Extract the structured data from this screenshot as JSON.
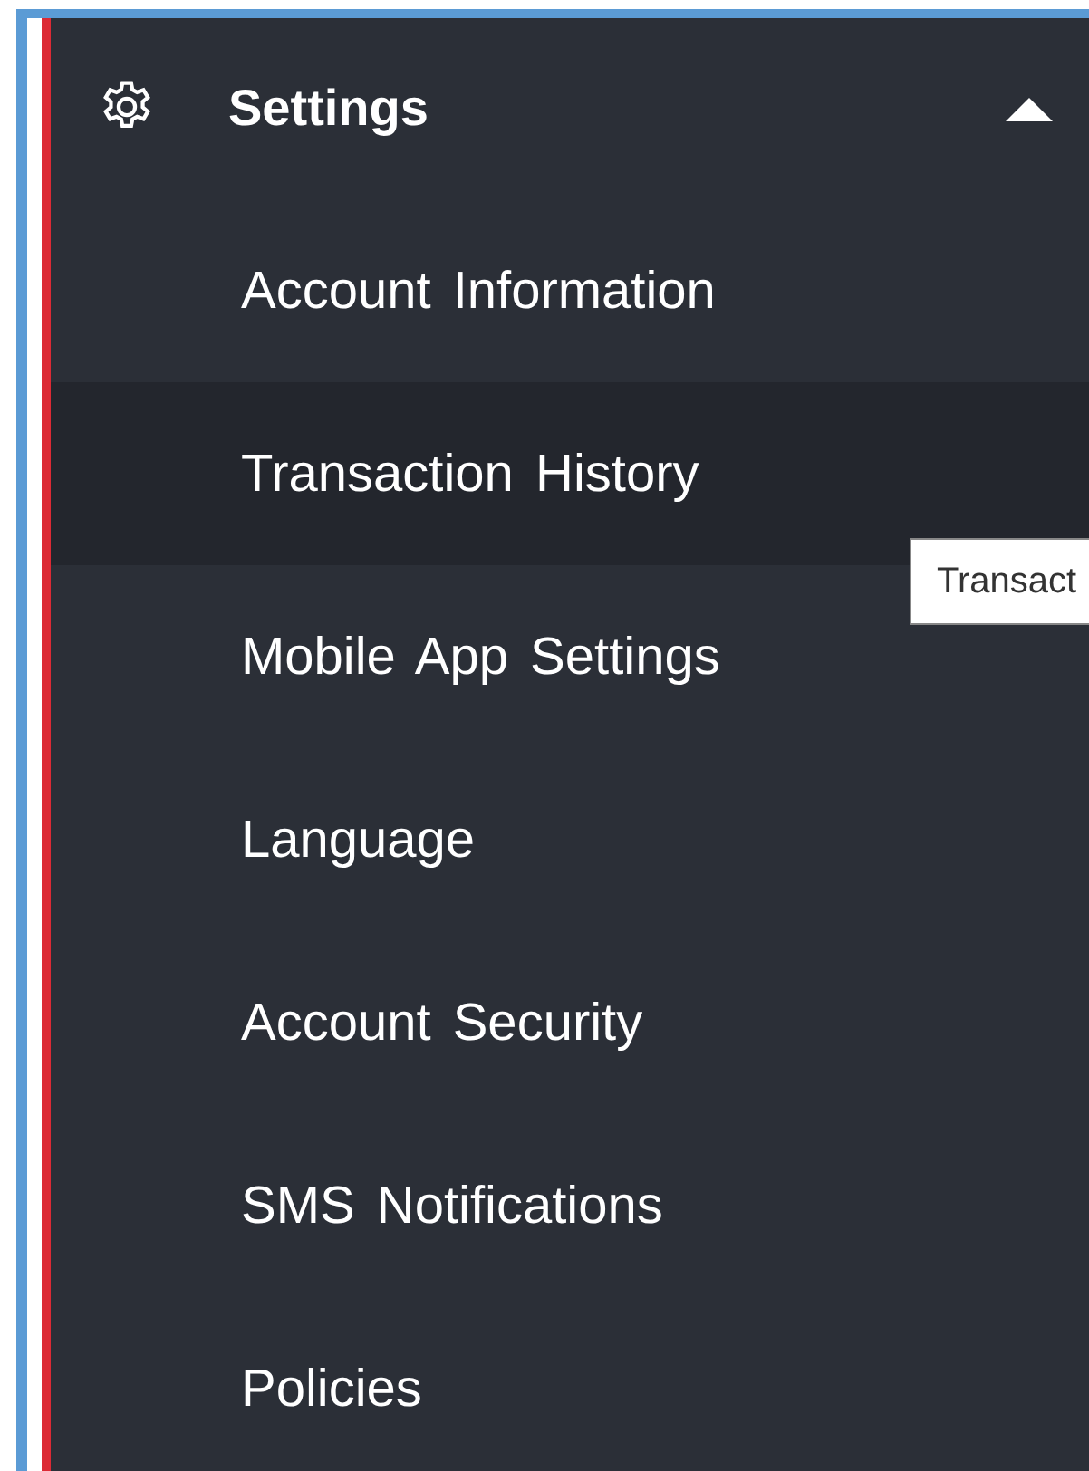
{
  "menu": {
    "title": "Settings",
    "expanded": true,
    "items": [
      {
        "label": "Account Information",
        "highlighted": false
      },
      {
        "label": "Transaction History",
        "highlighted": true
      },
      {
        "label": "Mobile App Settings",
        "highlighted": false
      },
      {
        "label": "Language",
        "highlighted": false
      },
      {
        "label": "Account Security",
        "highlighted": false
      },
      {
        "label": "SMS Notifications",
        "highlighted": false
      },
      {
        "label": "Policies",
        "highlighted": false
      }
    ]
  },
  "tooltip": {
    "text": "Transact"
  }
}
